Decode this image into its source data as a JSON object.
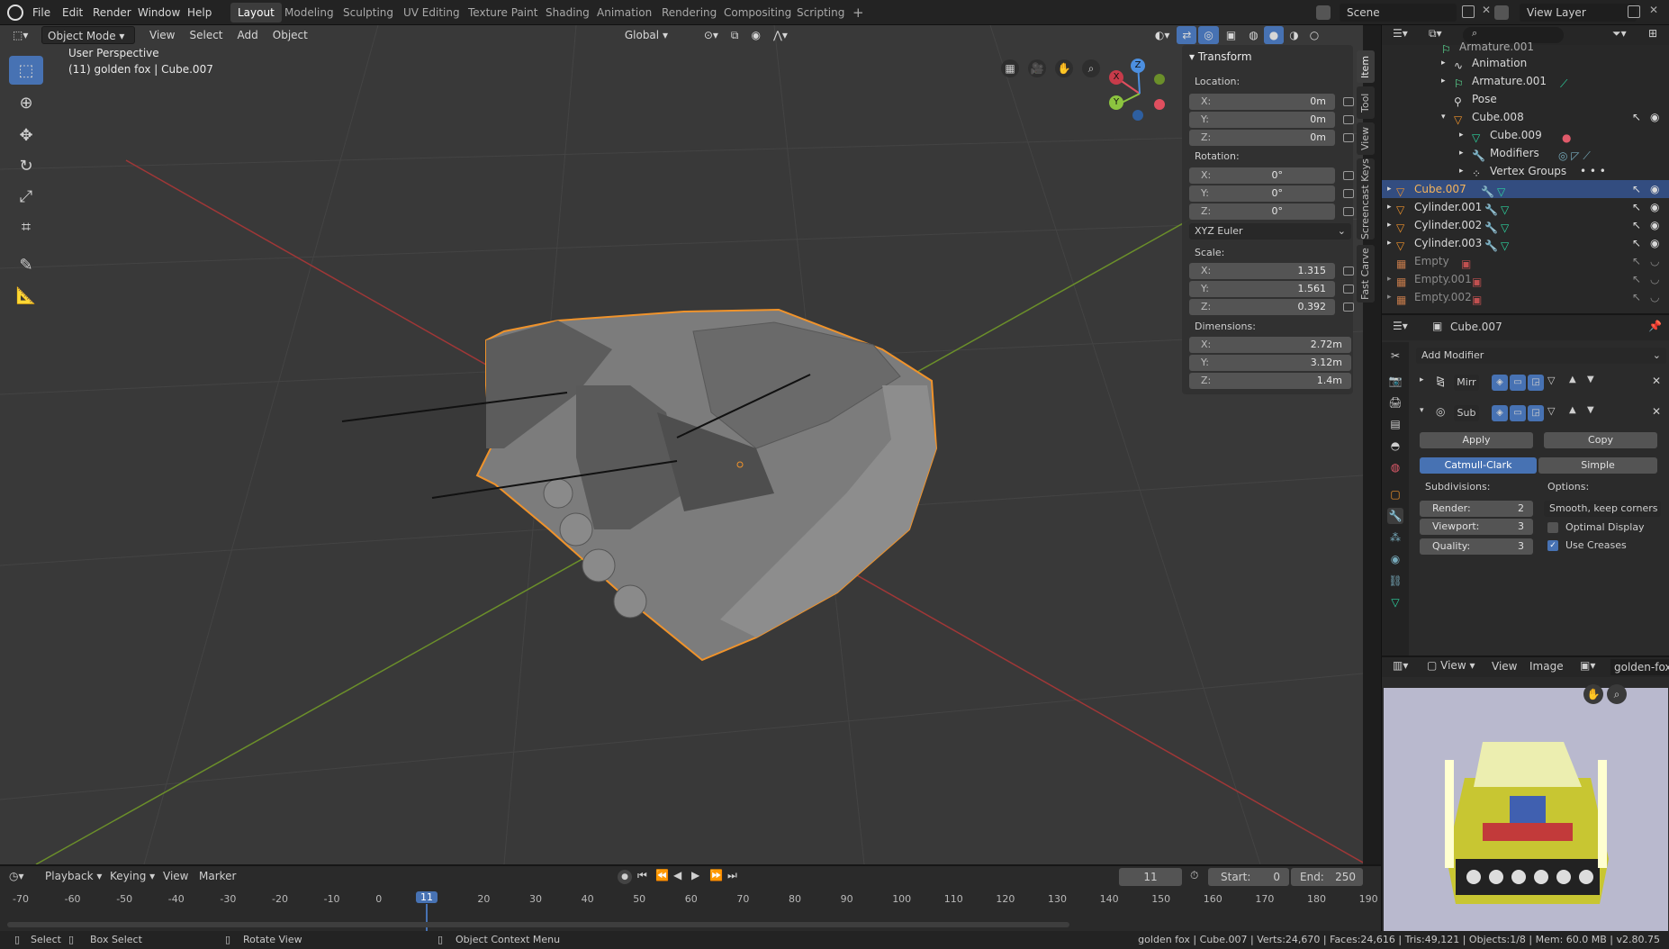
{
  "topbar": {
    "menus": [
      "File",
      "Edit",
      "Render",
      "Window",
      "Help"
    ],
    "workspaces": [
      "Layout",
      "Modeling",
      "Sculpting",
      "UV Editing",
      "Texture Paint",
      "Shading",
      "Animation",
      "Rendering",
      "Compositing",
      "Scripting"
    ],
    "active_workspace": "Layout",
    "add_tab": "+",
    "scene": "Scene",
    "view_layer": "View Layer"
  },
  "viewport": {
    "mode": "Object Mode",
    "menus": [
      "View",
      "Select",
      "Add",
      "Object"
    ],
    "orientation": "Global",
    "perspective": "User Perspective",
    "object_info": "(11) golden fox | Cube.007",
    "gizmo_x": "X",
    "gizmo_y": "Y",
    "gizmo_z": "Z"
  },
  "transform": {
    "header": "Transform",
    "location_label": "Location:",
    "rotation_label": "Rotation:",
    "scale_label": "Scale:",
    "dimensions_label": "Dimensions:",
    "rotation_mode": "XYZ Euler",
    "axis_x": "X:",
    "axis_y": "Y:",
    "axis_z": "Z:",
    "location": [
      "0m",
      "0m",
      "0m"
    ],
    "rotation": [
      "0°",
      "0°",
      "0°"
    ],
    "scale": [
      "1.315",
      "1.561",
      "0.392"
    ],
    "dimensions": [
      "2.72m",
      "3.12m",
      "1.4m"
    ]
  },
  "sidebar_tabs": [
    "Item",
    "Tool",
    "View",
    "Screencast Keys",
    "Fast Carve"
  ],
  "outliner": {
    "items": [
      {
        "name": "Armature.001"
      },
      {
        "name": "Animation"
      },
      {
        "name": "Armature.001"
      },
      {
        "name": "Pose"
      },
      {
        "name": "Cube.008"
      },
      {
        "name": "Cube.009"
      },
      {
        "name": "Modifiers"
      },
      {
        "name": "Vertex Groups"
      },
      {
        "name": "Cube.007"
      },
      {
        "name": "Cylinder.001"
      },
      {
        "name": "Cylinder.002"
      },
      {
        "name": "Cylinder.003"
      },
      {
        "name": "Empty"
      },
      {
        "name": "Empty.001"
      },
      {
        "name": "Empty.002"
      }
    ]
  },
  "properties": {
    "object_name": "Cube.007",
    "add_modifier": "Add Modifier",
    "modifier1": "Mirr",
    "modifier2": "Sub",
    "apply": "Apply",
    "copy": "Copy",
    "catmull": "Catmull-Clark",
    "simple": "Simple",
    "subdivisions_label": "Subdivisions:",
    "options_label": "Options:",
    "render_label": "Render:",
    "render_value": "2",
    "viewport_label": "Viewport:",
    "viewport_value": "3",
    "quality_label": "Quality:",
    "quality_value": "3",
    "uv_smooth": "Smooth, keep corners",
    "optimal_display": "Optimal Display",
    "use_creases": "Use Creases"
  },
  "image_editor": {
    "view1": "View",
    "view2": "View",
    "image": "Image",
    "image_name": "golden-fox-re"
  },
  "timeline": {
    "menus": [
      "Playback",
      "Keying",
      "View",
      "Marker"
    ],
    "current_frame": "11",
    "start_label": "Start:",
    "start": "0",
    "end_label": "End:",
    "end": "250",
    "ticks": [
      "-70",
      "-60",
      "-50",
      "-40",
      "-30",
      "-20",
      "-10",
      "0",
      "11",
      "20",
      "30",
      "40",
      "50",
      "60",
      "70",
      "80",
      "90",
      "100",
      "110",
      "120",
      "130",
      "140",
      "150",
      "160",
      "170",
      "180",
      "190"
    ]
  },
  "status": {
    "select": "Select",
    "box_select": "Box Select",
    "rotate_view": "Rotate View",
    "context_menu": "Object Context Menu",
    "info": "golden fox | Cube.007 | Verts:24,670 | Faces:24,616 | Tris:49,121 | Objects:1/8 | Mem: 60.0 MB | v2.80.75"
  }
}
